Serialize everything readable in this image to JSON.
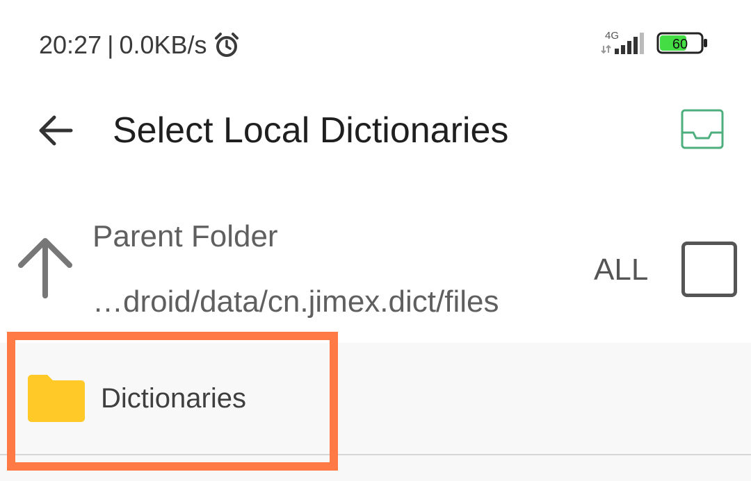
{
  "status_bar": {
    "time": "20:27",
    "separator": "|",
    "net_speed": "0.0KB/s",
    "network_type": "4G",
    "battery_level": "60",
    "battery_color": "#44dd44",
    "icons": [
      "alarm-icon",
      "signal-icon",
      "battery-icon"
    ]
  },
  "toolbar": {
    "title": "Select Local Dictionaries",
    "back_icon": "arrow-left-icon",
    "action_icon": "inbox-tray-icon",
    "action_color": "#4caf7d"
  },
  "parent_folder": {
    "label": "Parent Folder",
    "path": "…droid/data/cn.jimex.dict/files",
    "icon": "arrow-up-icon",
    "select_all_label": "ALL",
    "select_all_checked": false
  },
  "list": {
    "items": [
      {
        "label": "Dictionaries",
        "icon": "folder-icon",
        "icon_color": "#ffca28",
        "highlighted": true
      }
    ],
    "highlight_color": "#ff7a45"
  }
}
